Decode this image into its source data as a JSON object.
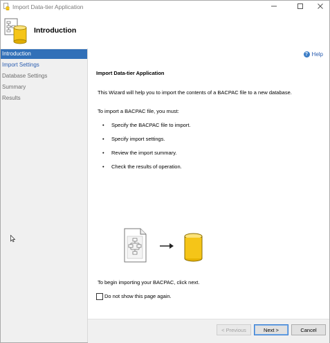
{
  "window": {
    "title": "Import Data-tier Application",
    "minimize_icon": "minimize-icon",
    "maximize_icon": "maximize-icon",
    "close_icon": "close-icon"
  },
  "header": {
    "title": "Introduction",
    "icon": "wizard-database-icon"
  },
  "sidebar": {
    "items": [
      {
        "label": "Introduction",
        "state": "active"
      },
      {
        "label": "Import Settings",
        "state": "enabled"
      },
      {
        "label": "Database Settings",
        "state": "disabled"
      },
      {
        "label": "Summary",
        "state": "disabled"
      },
      {
        "label": "Results",
        "state": "disabled"
      }
    ]
  },
  "help": {
    "label": "Help",
    "icon": "help-icon"
  },
  "content": {
    "heading": "Import Data-tier Application",
    "intro": "This Wizard will help you to import the contents of a BACPAC file to a new database.",
    "must_label": "To import a BACPAC file, you must:",
    "steps": [
      "Specify the BACPAC file to import.",
      "Specify import settings.",
      "Review the import summary.",
      "Check the results of operation."
    ],
    "begin_text": "To begin importing your BACPAC, click next.",
    "dont_show_label": "Do not show this page again.",
    "dont_show_checked": false
  },
  "footer": {
    "previous_label": "< Previous",
    "next_label": "Next >",
    "cancel_label": "Cancel"
  },
  "colors": {
    "accent": "#3170b8",
    "link": "#2a5db0",
    "sidebar_bg": "#f0f0f0",
    "db_yellow": "#f5c518"
  }
}
